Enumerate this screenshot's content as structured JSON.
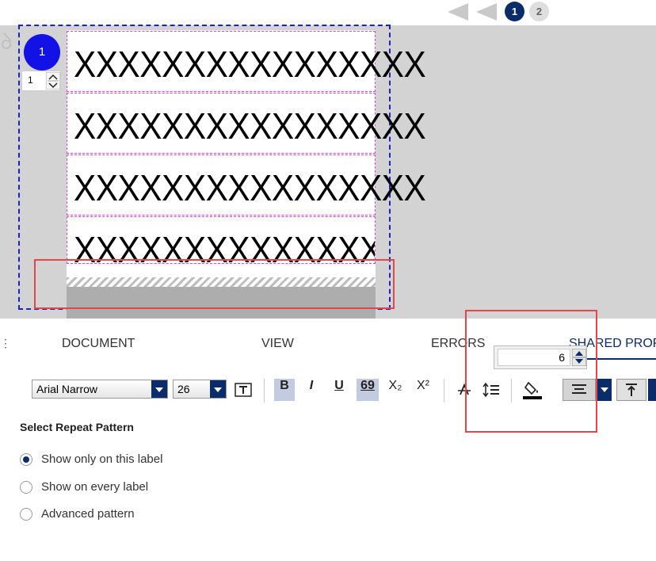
{
  "pager": {
    "pages": [
      "1",
      "2"
    ],
    "current": "1"
  },
  "label": {
    "number": "1",
    "copies": "1",
    "rows": [
      "XXXXXXXXXXXXXXXX",
      "XXXXXXXXXXXXXXXX",
      "XXXXXXXXXXXXXXXX",
      "XXXXXXXXXXXXXXXX"
    ]
  },
  "tabs": [
    "DOCUMENT",
    "VIEW",
    "ERRORS",
    "SHARED PROP"
  ],
  "spin_value": "6",
  "toolbar": {
    "font": "Arial Narrow",
    "size": "26",
    "bold": "B",
    "italic": "I",
    "underline": "U",
    "digit": "69",
    "subscript": "X₂",
    "superscript": "X²"
  },
  "repeat": {
    "heading": "Select Repeat Pattern",
    "options": [
      "Show only on this label",
      "Show on every label",
      "Advanced pattern"
    ],
    "selected": "Show only on this label"
  },
  "colors": {
    "accent": "#0b2c6b",
    "highlight": "#e0474c",
    "label_marker": "#1212e6",
    "row_border": "#e040e0"
  },
  "icons": [
    "back-arrow-icon",
    "forward-arrow-icon",
    "text-fit-icon",
    "strikethrough-icon",
    "line-spacing-icon",
    "fill-color-icon",
    "align-center-icon",
    "align-top-icon"
  ]
}
